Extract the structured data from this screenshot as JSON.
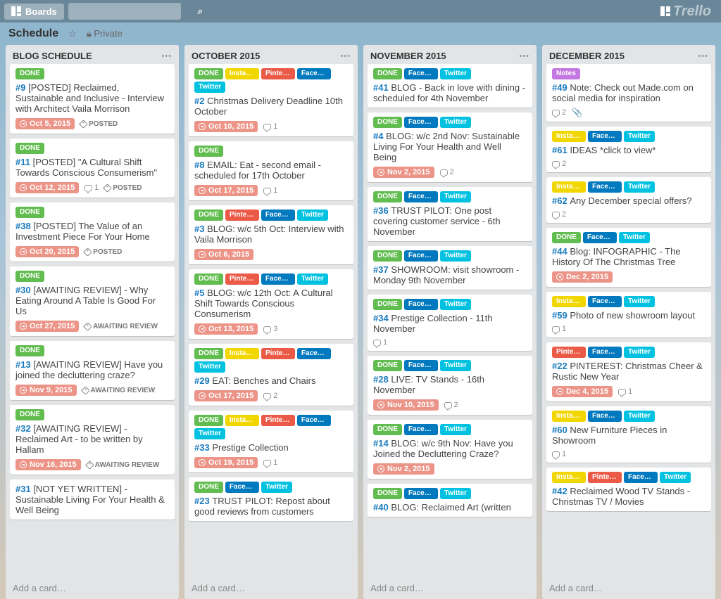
{
  "topbar": {
    "boards": "Boards",
    "logo": "Trello"
  },
  "board": {
    "title": "Schedule",
    "privacy": "Private"
  },
  "addCard": "Add a card…",
  "labels": {
    "done": "DONE",
    "insta": "Instag…",
    "pint": "Pinter…",
    "fb": "Faceb…",
    "tw": "Twitter",
    "notes": "Notes"
  },
  "lists": [
    {
      "title": "BLOG SCHEDULE",
      "cards": [
        {
          "labels": [
            "done"
          ],
          "num": "#9",
          "title": "[POSTED] Reclaimed, Sustainable and Inclusive - Interview with Architect Vaila Morrison",
          "due": "Oct 5, 2015",
          "tag": "POSTED"
        },
        {
          "labels": [
            "done"
          ],
          "num": "#11",
          "title": "[POSTED] \"A Cultural Shift Towards Conscious Consumerism\"",
          "due": "Oct 12, 2015",
          "comments": 1,
          "tag": "POSTED"
        },
        {
          "labels": [
            "done"
          ],
          "num": "#38",
          "title": "[POSTED] The Value of an Investment Piece For Your Home",
          "due": "Oct 20, 2015",
          "tag": "POSTED"
        },
        {
          "labels": [
            "done"
          ],
          "num": "#30",
          "title": "[AWAITING REVIEW] - Why Eating Around A Table Is Good For Us",
          "due": "Oct 27, 2015",
          "tag": "AWAITING REVIEW"
        },
        {
          "labels": [
            "done"
          ],
          "num": "#13",
          "title": "[AWAITING REVIEW] Have you joined the decluttering craze?",
          "due": "Nov 9, 2015",
          "tag": "AWAITING REVIEW"
        },
        {
          "labels": [
            "done"
          ],
          "num": "#32",
          "title": "[AWAITING REVIEW] - Reclaimed Art - to be written by Hallam",
          "due": "Nov 16, 2015",
          "tag": "AWAITING REVIEW"
        },
        {
          "labels": [],
          "num": "#31",
          "title": "[NOT YET WRITTEN] - Sustainable Living For Your Health & Well Being"
        }
      ]
    },
    {
      "title": "OCTOBER 2015",
      "cards": [
        {
          "labels": [
            "done",
            "insta",
            "pint",
            "fb",
            "tw"
          ],
          "num": "#2",
          "title": "Christmas Delivery Deadline 10th October",
          "due": "Oct 10, 2015",
          "comments": 1
        },
        {
          "labels": [
            "done"
          ],
          "num": "#8",
          "title": "EMAIL: Eat - second email - scheduled for 17th October",
          "due": "Oct 17, 2015",
          "comments": 1
        },
        {
          "labels": [
            "done",
            "pint",
            "fb",
            "tw"
          ],
          "num": "#3",
          "title": "BLOG: w/c 5th Oct: Interview with Vaila Morrison",
          "due": "Oct 6, 2015"
        },
        {
          "labels": [
            "done",
            "pint",
            "fb",
            "tw"
          ],
          "num": "#5",
          "title": "BLOG: w/c 12th Oct: A Cultural Shift Towards Conscious Consumerism",
          "due": "Oct 13, 2015",
          "comments": 3
        },
        {
          "labels": [
            "done",
            "insta",
            "pint",
            "fb",
            "tw"
          ],
          "num": "#29",
          "title": "EAT: Benches and Chairs",
          "due": "Oct 17, 2015",
          "comments": 2
        },
        {
          "labels": [
            "done",
            "insta",
            "pint",
            "fb",
            "tw"
          ],
          "num": "#33",
          "title": "Prestige Collection",
          "due": "Oct 19, 2015",
          "comments": 1
        },
        {
          "labels": [
            "done",
            "fb",
            "tw"
          ],
          "num": "#23",
          "title": "TRUST PILOT: Repost about good reviews from customers"
        }
      ]
    },
    {
      "title": "NOVEMBER 2015",
      "cards": [
        {
          "labels": [
            "done",
            "fb",
            "tw"
          ],
          "num": "#41",
          "title": "BLOG - Back in love with dining - scheduled for 4th November"
        },
        {
          "labels": [
            "done",
            "fb",
            "tw"
          ],
          "num": "#4",
          "title": "BLOG: w/c 2nd Nov: Sustainable Living For Your Health and Well Being",
          "due": "Nov 2, 2015",
          "comments": 2
        },
        {
          "labels": [
            "done",
            "fb",
            "tw"
          ],
          "num": "#36",
          "title": "TRUST PILOT: One post covering customer service - 6th November"
        },
        {
          "labels": [
            "done",
            "fb",
            "tw"
          ],
          "num": "#37",
          "title": "SHOWROOM: visit showroom - Monday 9th November"
        },
        {
          "labels": [
            "done",
            "fb",
            "tw"
          ],
          "num": "#34",
          "title": "Prestige Collection - 11th November",
          "comments": 1
        },
        {
          "labels": [
            "done",
            "fb",
            "tw"
          ],
          "num": "#28",
          "title": "LIVE: TV Stands - 16th November",
          "due": "Nov 10, 2015",
          "comments": 2
        },
        {
          "labels": [
            "done",
            "fb",
            "tw"
          ],
          "num": "#14",
          "title": "BLOG: w/c 9th Nov: Have you Joined the Decluttering Craze?",
          "due": "Nov 2, 2015"
        },
        {
          "labels": [
            "done",
            "fb",
            "tw"
          ],
          "num": "#40",
          "title": "BLOG: Reclaimed Art (written"
        }
      ]
    },
    {
      "title": "DECEMBER 2015",
      "cards": [
        {
          "labels": [
            "notes"
          ],
          "num": "#49",
          "title": "Note: Check out Made.com on social media for inspiration",
          "comments": 2,
          "att": true
        },
        {
          "labels": [
            "insta",
            "fb",
            "tw"
          ],
          "num": "#61",
          "title": "IDEAS *click to view*",
          "comments": 2
        },
        {
          "labels": [
            "insta",
            "fb",
            "tw"
          ],
          "num": "#62",
          "title": "Any December special offers?",
          "comments": 2
        },
        {
          "labels": [
            "done",
            "fb",
            "tw"
          ],
          "num": "#44",
          "title": "Blog: INFOGRAPHIC - The History Of The Christmas Tree",
          "due": "Dec 2, 2015"
        },
        {
          "labels": [
            "insta",
            "fb",
            "tw"
          ],
          "num": "#59",
          "title": "Photo of new showroom layout",
          "comments": 1
        },
        {
          "labels": [
            "pint",
            "fb",
            "tw"
          ],
          "num": "#22",
          "title": "PINTEREST: Christmas Cheer & Rustic New Year",
          "due": "Dec 4, 2015",
          "comments": 1
        },
        {
          "labels": [
            "insta",
            "fb",
            "tw"
          ],
          "num": "#60",
          "title": "New Furniture Pieces in Showroom",
          "comments": 1
        },
        {
          "labels": [
            "insta",
            "pint",
            "fb",
            "tw"
          ],
          "num": "#42",
          "title": "Reclaimed Wood TV Stands - Christmas TV / Movies"
        }
      ]
    }
  ]
}
